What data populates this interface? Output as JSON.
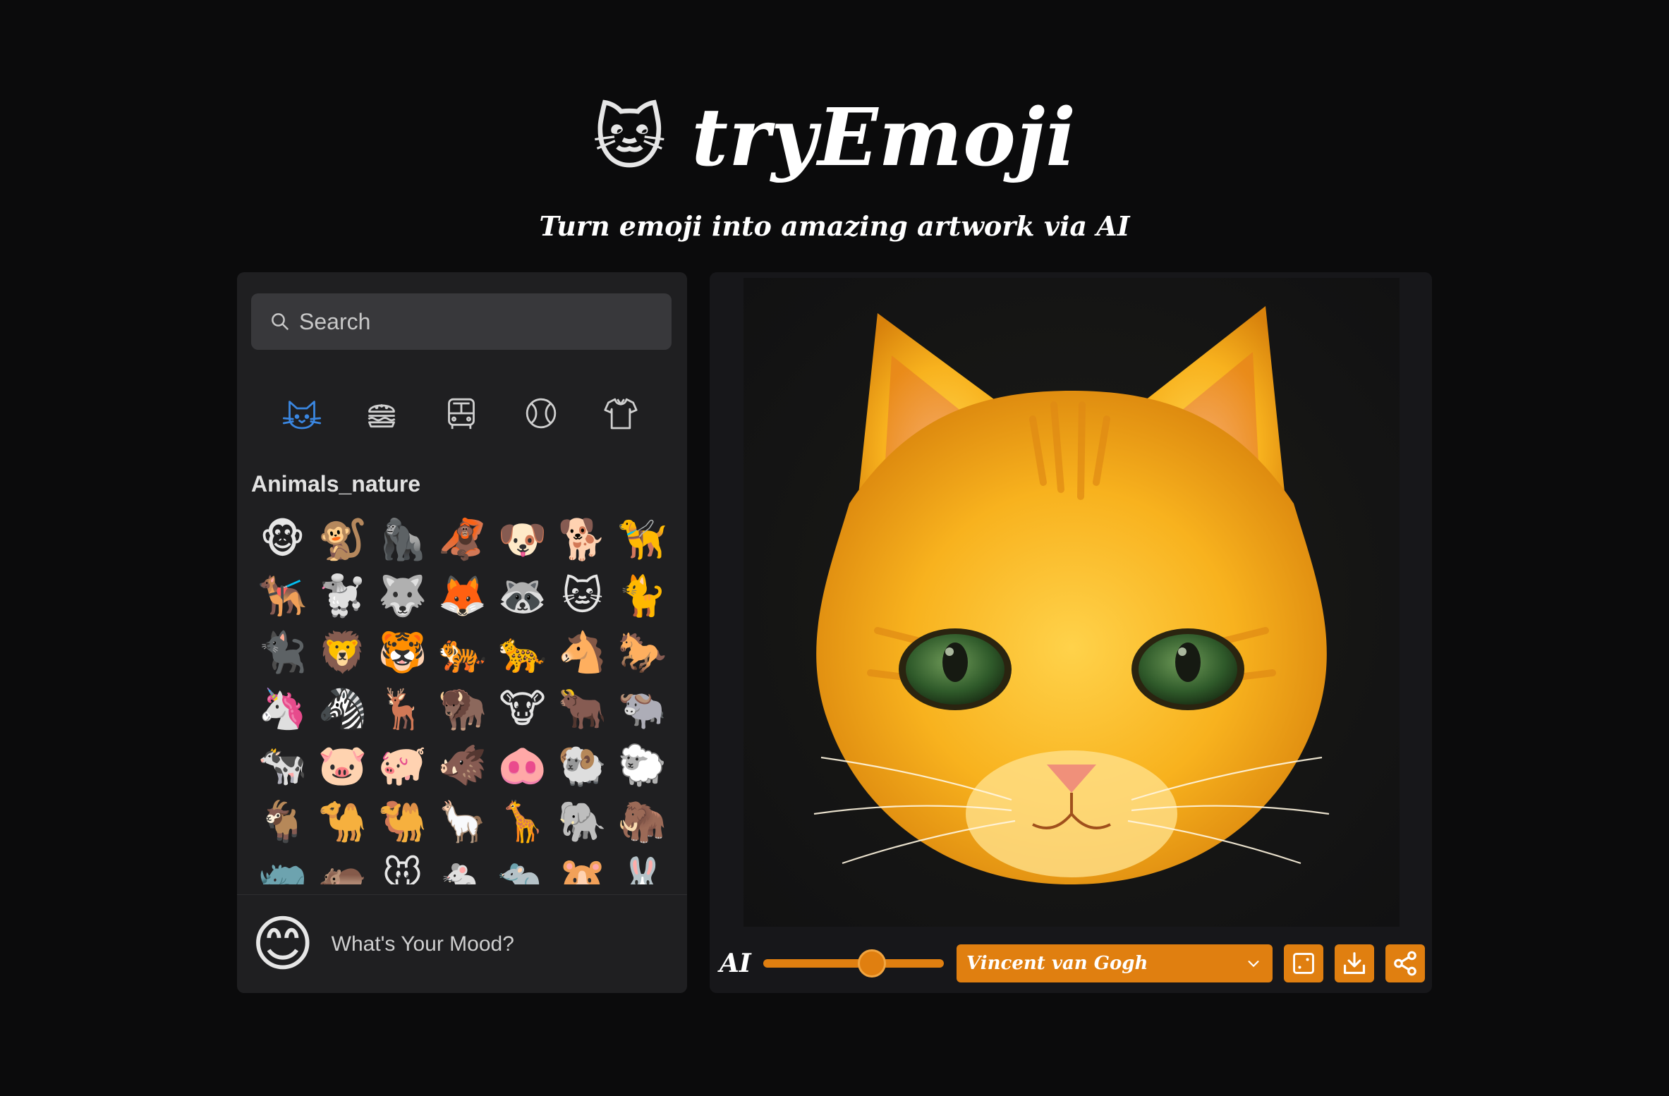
{
  "header": {
    "logo_emoji": "🐱",
    "title": "tryEmoji",
    "tagline": "Turn emoji into amazing artwork via AI"
  },
  "picker": {
    "search": {
      "placeholder": "Search",
      "value": ""
    },
    "categories": [
      {
        "name": "animals",
        "icon": "cat-icon",
        "active": true
      },
      {
        "name": "food",
        "icon": "burger-icon",
        "active": false
      },
      {
        "name": "travel",
        "icon": "bus-icon",
        "active": false
      },
      {
        "name": "activities",
        "icon": "ball-icon",
        "active": false
      },
      {
        "name": "objects",
        "icon": "shirt-icon",
        "active": false
      }
    ],
    "section_title": "Animals_nature",
    "emojis": [
      "🐵",
      "🐒",
      "🦍",
      "🦧",
      "🐶",
      "🐕",
      "🦮",
      "🐕‍🦺",
      "🐩",
      "🐺",
      "🦊",
      "🦝",
      "🐱",
      "🐈",
      "🐈‍⬛",
      "🦁",
      "🐯",
      "🐅",
      "🐆",
      "🐴",
      "🐎",
      "🦄",
      "🦓",
      "🦌",
      "🦬",
      "🐮",
      "🐂",
      "🐃",
      "🐄",
      "🐷",
      "🐖",
      "🐗",
      "🐽",
      "🐏",
      "🐑",
      "🐐",
      "🐪",
      "🐫",
      "🦙",
      "🦒",
      "🐘",
      "🦣",
      "🦏",
      "🦛",
      "🐭",
      "🐁",
      "🐀",
      "🐹",
      "🐰"
    ],
    "mood": {
      "emoji": "😊",
      "label": "What's Your Mood?"
    }
  },
  "artwork": {
    "ai_label": "AI",
    "strength": 0.62,
    "style": "Vincent van Gogh",
    "colors": {
      "accent": "#e07f10",
      "panel": "#17171a"
    }
  }
}
